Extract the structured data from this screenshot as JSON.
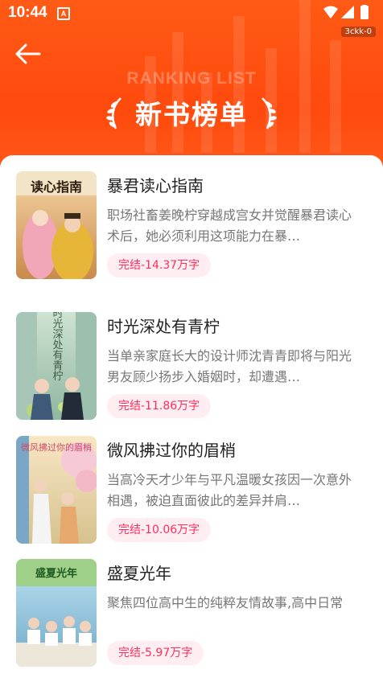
{
  "status_bar": {
    "time": "10:44",
    "notification_icon": "A",
    "build_tag": "3ckk-0",
    "icons": [
      "wifi-icon",
      "signal-icon",
      "battery-icon"
    ]
  },
  "header": {
    "back_icon": "arrow-left-icon",
    "ghost_title": "RANKING LIST",
    "title": "新书榜单"
  },
  "books": [
    {
      "title": "暴君读心指南",
      "description": "职场社畜姜晚柠穿越成宫女并觉醒暴君读心术后，她必须利用这项能力在暴…",
      "badge": "完结-14.37万字",
      "cover_text": "读心指南"
    },
    {
      "title": "时光深处有青柠",
      "description": "当单亲家庭长大的设计师沈青青即将与阳光男友顾少扬步入婚姻时，却遭遇…",
      "badge": "完结-11.86万字",
      "cover_text": "时光深处有青柠"
    },
    {
      "title": "微风拂过你的眉梢",
      "description": "当高冷天才少年与平凡温暖女孩因一次意外相遇，被迫直面彼此的差异并肩…",
      "badge": "完结-10.06万字",
      "cover_text": "微风拂过你的眉梢"
    },
    {
      "title": "盛夏光年",
      "description": "聚焦四位高中生的纯粹友情故事,高中日常",
      "badge": "完结-5.97万字",
      "cover_text": "盛夏光年"
    }
  ],
  "colors": {
    "header_bg": "#ff4e10",
    "badge_text": "#ff2e5d",
    "badge_bg": "#ffeef1",
    "title_text": "#222222",
    "desc_text": "#777777"
  }
}
